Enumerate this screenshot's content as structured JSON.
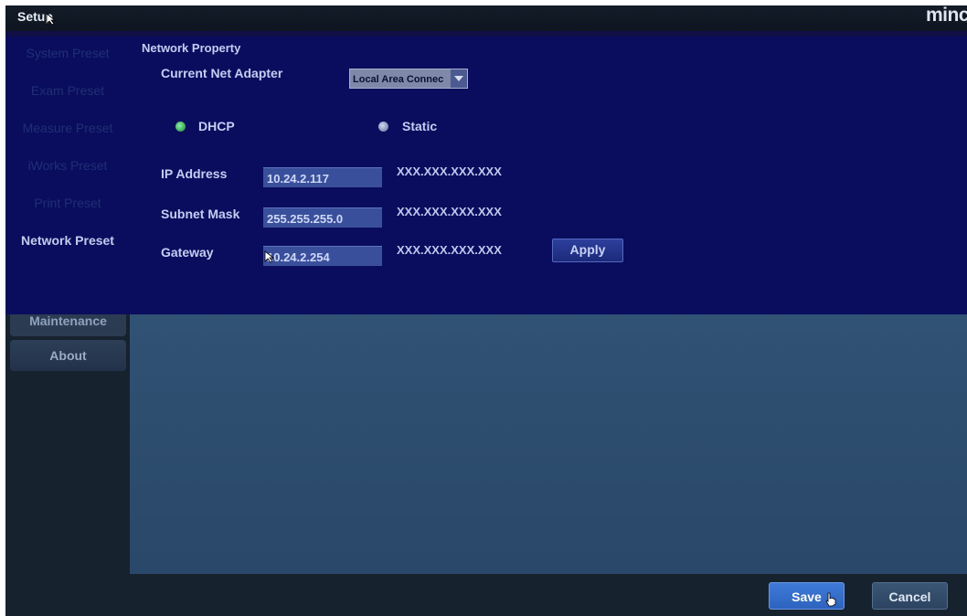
{
  "window": {
    "title": "Setup",
    "logo_text": "minc"
  },
  "sidebar": {
    "items": [
      {
        "label": "System Preset"
      },
      {
        "label": "Exam Preset"
      },
      {
        "label": "Measure Preset"
      },
      {
        "label": "iWorks Preset"
      },
      {
        "label": "Print Preset"
      },
      {
        "label": "Network Preset"
      },
      {
        "label": "Maintenance"
      },
      {
        "label": "About"
      }
    ],
    "active": "Network Preset"
  },
  "network": {
    "section_title": "Network Property",
    "adapter_label": "Current Net Adapter",
    "adapter_value": "Local Area Connec",
    "dhcp_label": "DHCP",
    "static_label": "Static",
    "selected_mode": "DHCP",
    "ip_label": "IP Address",
    "ip_value": "10.24.2.117",
    "ip_format": "XXX.XXX.XXX.XXX",
    "subnet_label": "Subnet Mask",
    "subnet_value": "255.255.255.0",
    "subnet_format": "XXX.XXX.XXX.XXX",
    "gateway_label": "Gateway",
    "gateway_value": "10.24.2.254",
    "gateway_format": "XXX.XXX.XXX.XXX",
    "apply_label": "Apply"
  },
  "footer": {
    "save_label": "Save",
    "cancel_label": "Cancel"
  },
  "colors": {
    "dialog_bg": "#0a0d5e",
    "content_bg": "#2f5072",
    "dhcp_radio": "#3fb35a",
    "static_radio": "#8c95bd",
    "save_button": "#3f7ad8"
  }
}
